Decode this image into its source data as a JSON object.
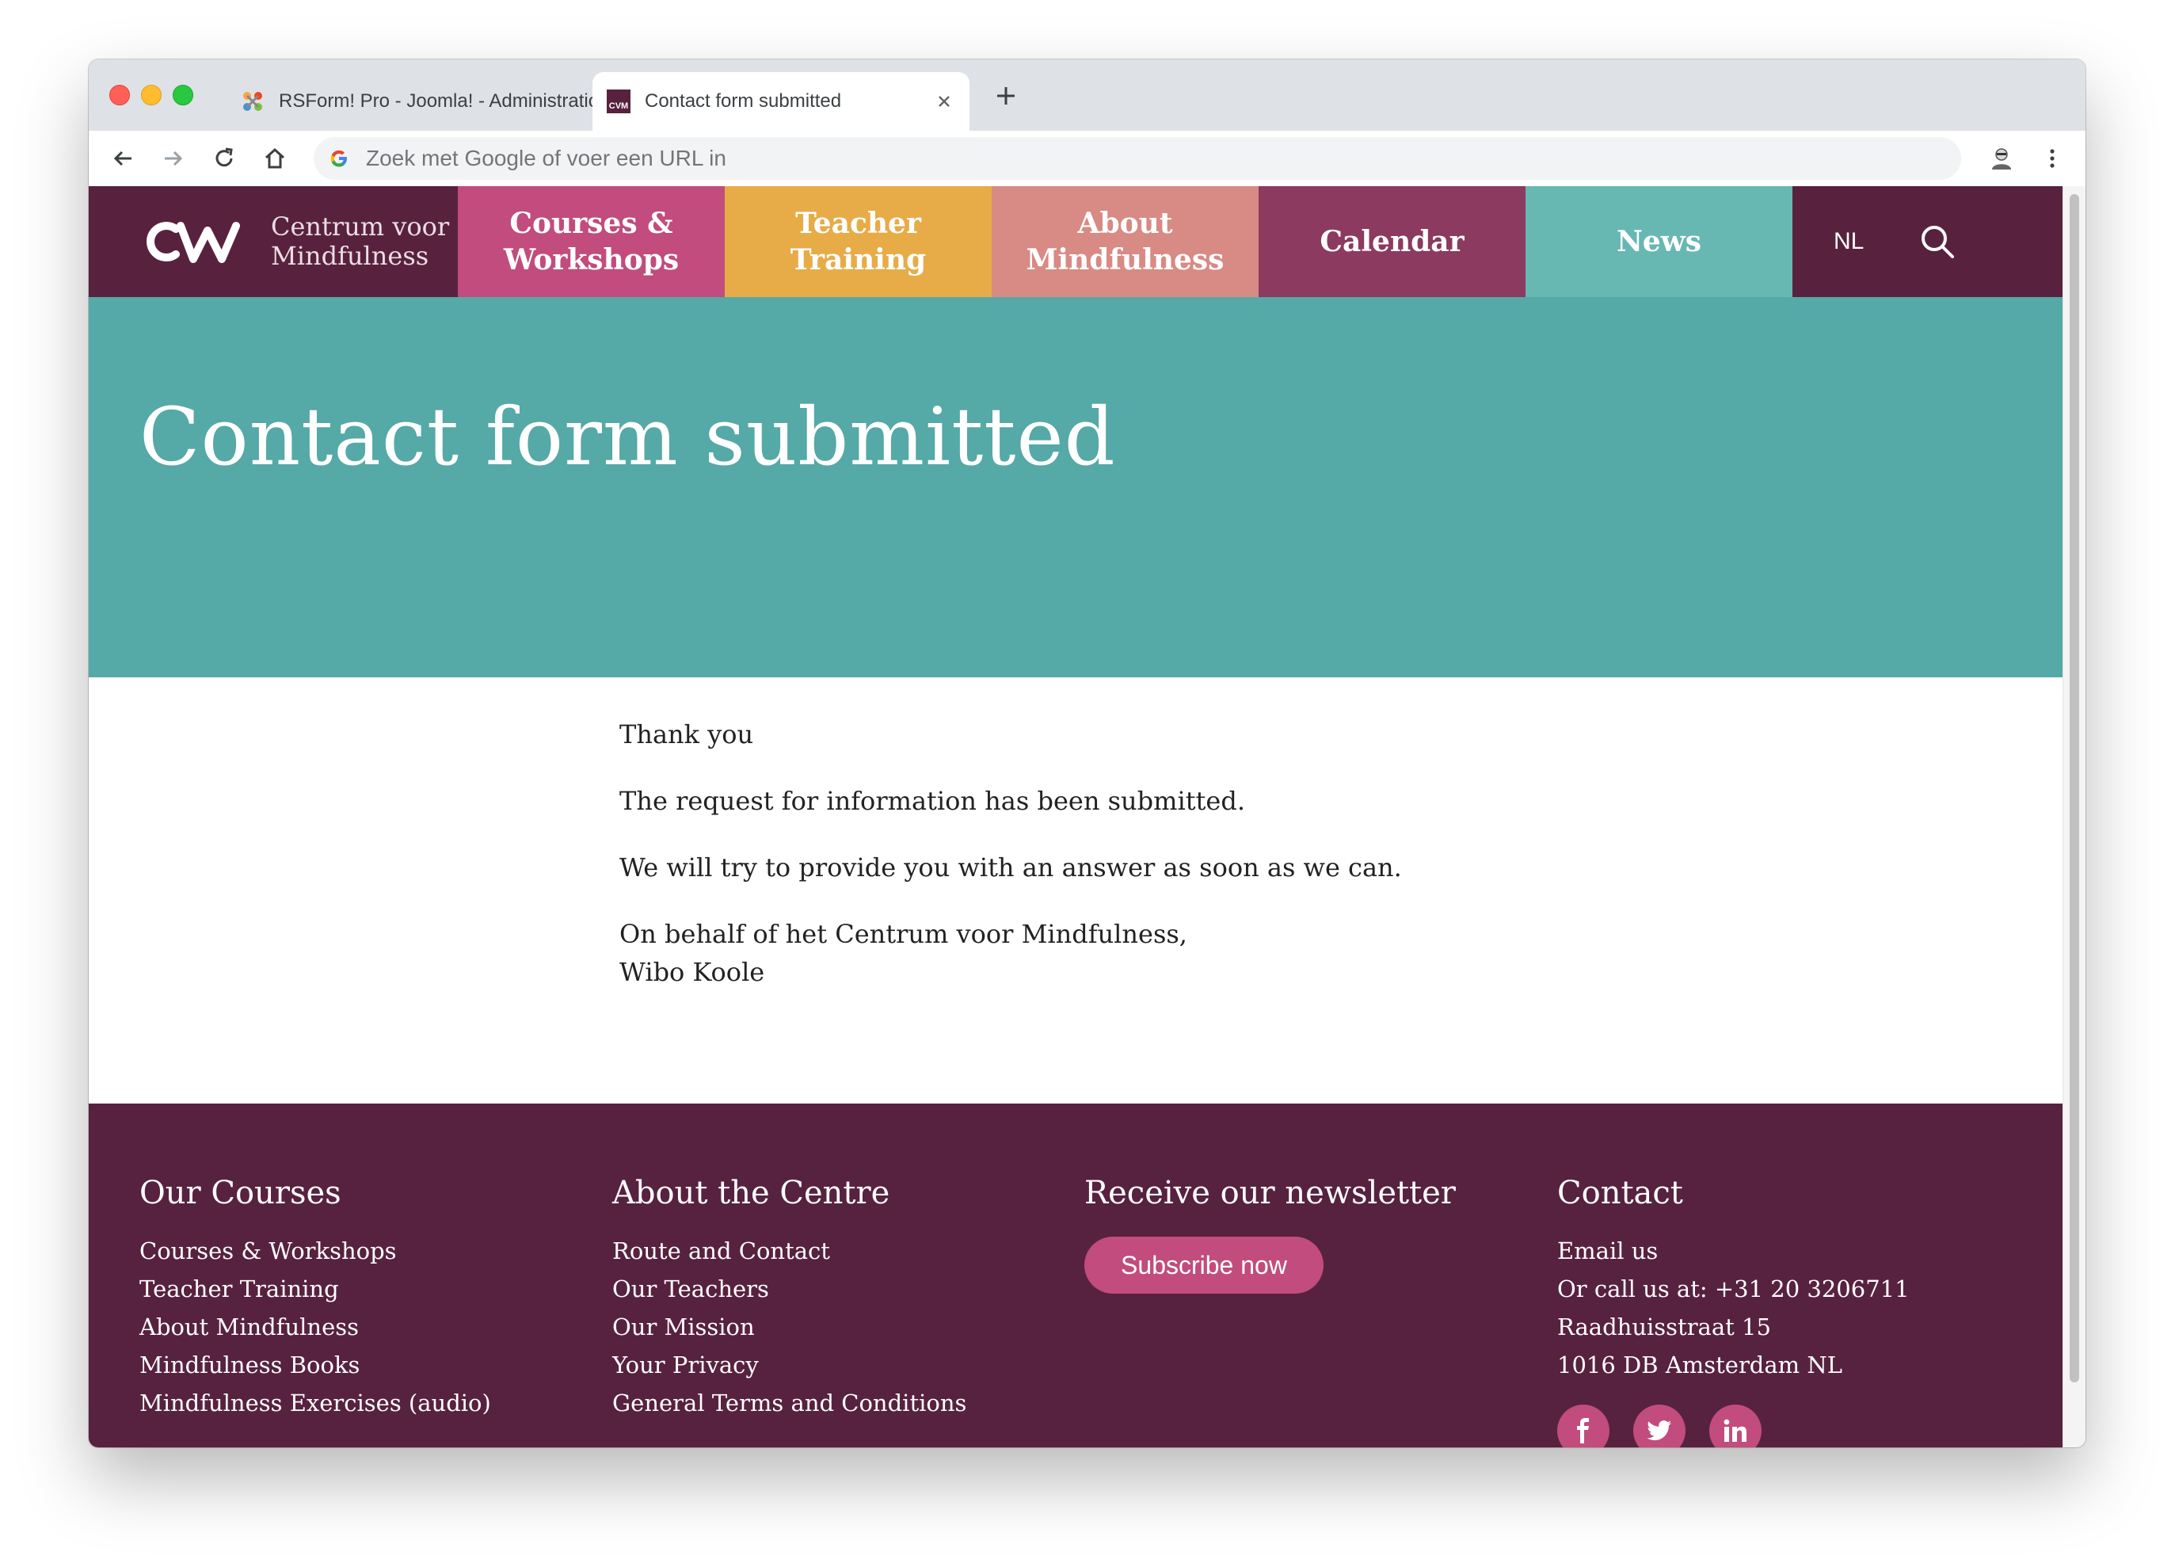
{
  "browser": {
    "tabs": [
      {
        "title": "RSForm! Pro - Joomla! - Administration"
      },
      {
        "title": "Contact form submitted"
      }
    ],
    "omnibox_placeholder": "Zoek met Google of voer een URL in"
  },
  "site": {
    "logo_line1": "Centrum voor",
    "logo_line2": "Mindfulness",
    "nav": {
      "courses_line1": "Courses &",
      "courses_line2": "Workshops",
      "teacher_line1": "Teacher",
      "teacher_line2": "Training",
      "about_line1": "About",
      "about_line2": "Mindfulness",
      "calendar": "Calendar",
      "news": "News",
      "lang": "NL"
    },
    "colors": {
      "header": "#58223e",
      "courses": "#c14c7d",
      "teacher": "#e7ac48",
      "about": "#d88a84",
      "calendar": "#8c3a5f",
      "news": "#67b7b2",
      "hero": "#55a9a7",
      "footer": "#57223f"
    }
  },
  "hero": {
    "title": "Contact form submitted"
  },
  "content": {
    "p1": "Thank you",
    "p2": "The request for information has been submitted.",
    "p3": "We will try to provide you with an answer as soon as we can.",
    "p4_line1": "On behalf of het Centrum voor Mindfulness,",
    "p4_line2": "Wibo Koole"
  },
  "footer": {
    "courses": {
      "heading": "Our Courses",
      "links": [
        "Courses & Workshops",
        "Teacher Training",
        "About Mindfulness",
        "Mindfulness Books",
        "Mindfulness Exercises (audio)"
      ]
    },
    "about": {
      "heading": "About the Centre",
      "links": [
        "Route and Contact",
        "Our Teachers",
        "Our Mission",
        "Your Privacy",
        "General Terms and Conditions"
      ]
    },
    "newsletter": {
      "heading": "Receive our newsletter",
      "button": "Subscribe now"
    },
    "contact": {
      "heading": "Contact",
      "lines": [
        "Email us",
        "Or call us at: +31 20 3206711",
        "Raadhuisstraat 15",
        "1016 DB Amsterdam NL"
      ],
      "social": [
        "facebook-icon",
        "twitter-icon",
        "linkedin-icon"
      ]
    }
  }
}
